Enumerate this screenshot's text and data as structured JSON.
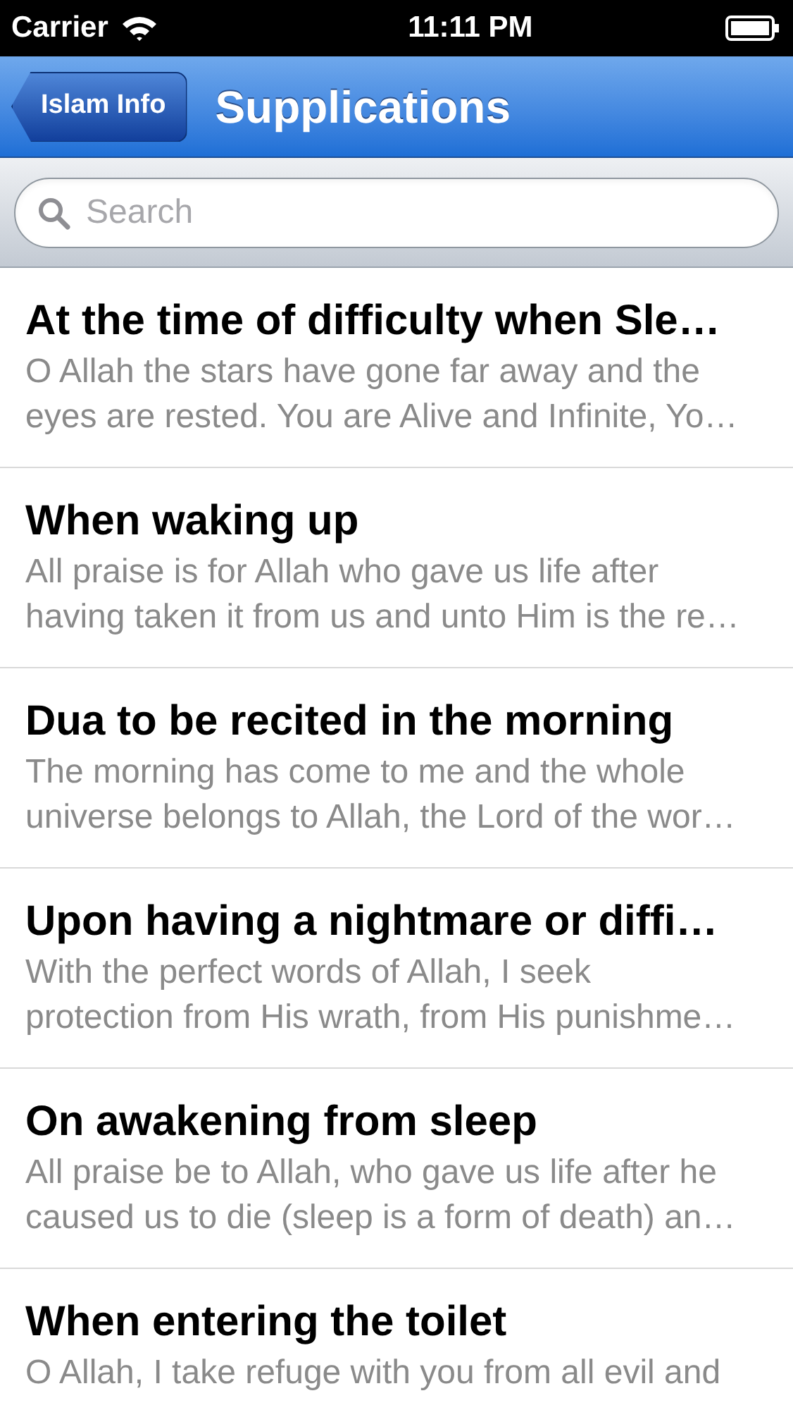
{
  "status_bar": {
    "carrier": "Carrier",
    "time": "11:11 PM"
  },
  "nav": {
    "back": "Islam Info",
    "title": "Supplications"
  },
  "search": {
    "placeholder": "Search"
  },
  "rows": [
    {
      "title": "At the time of difficulty when Sle…",
      "lines": [
        "O Allah the stars have gone far away and the",
        "eyes are rested. You are Alive and Infinite, Yo…"
      ]
    },
    {
      "title": "When waking up",
      "lines": [
        "All praise is for Allah who gave us life after",
        "having taken it from us and unto Him is the re…"
      ]
    },
    {
      "title": "Dua to be recited in the morning",
      "lines": [
        "The morning has come to me and the whole",
        "universe belongs to Allah, the Lord of the wor…"
      ]
    },
    {
      "title": "Upon having a nightmare or diffi…",
      "lines": [
        "With the perfect words of Allah, I seek",
        "protection from His wrath, from His punishme…"
      ]
    },
    {
      "title": "On awakening from sleep",
      "lines": [
        "All praise be to Allah, who gave us life after he",
        "caused us to die (sleep is a form of death) an…"
      ]
    },
    {
      "title": "When entering the toilet",
      "lines": [
        "O Allah, I take refuge with you from all evil and"
      ]
    }
  ]
}
